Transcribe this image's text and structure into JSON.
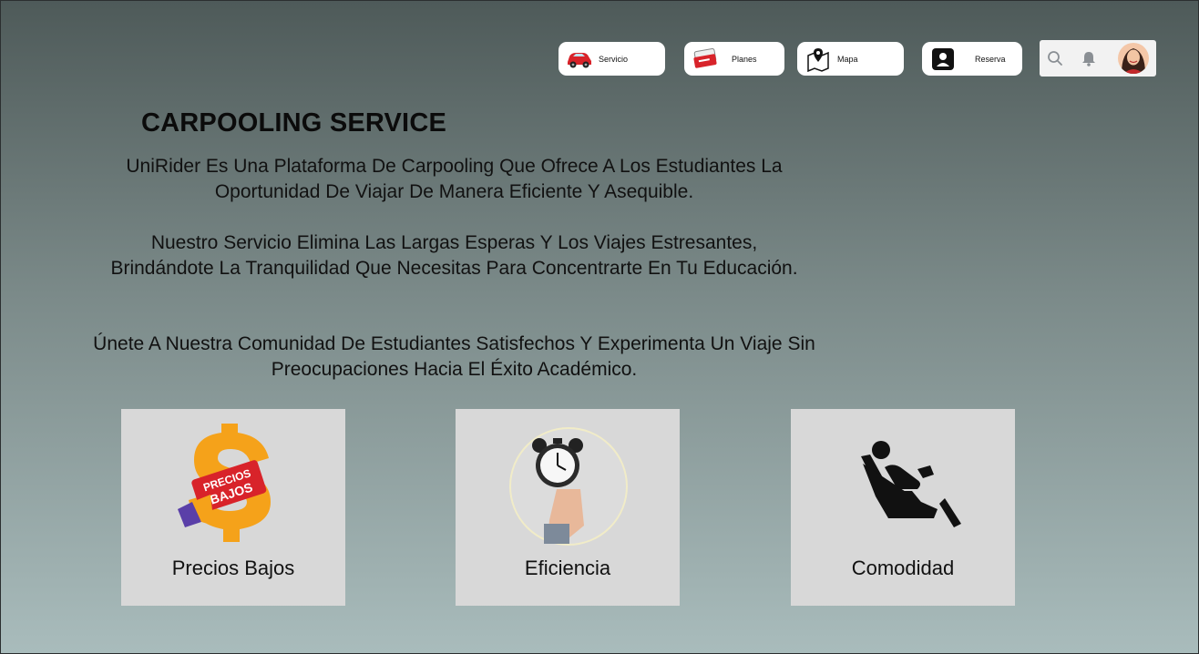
{
  "nav": {
    "items": [
      {
        "label": "Servicio",
        "icon": "car-icon"
      },
      {
        "label": "Planes",
        "icon": "ticket-icon"
      },
      {
        "label": "Mapa",
        "icon": "map-pin-icon"
      },
      {
        "label": "Reserva",
        "icon": "user-card-icon"
      }
    ],
    "utilities": {
      "search": "search-icon",
      "notifications": "bell-icon",
      "avatar": "avatar"
    }
  },
  "hero": {
    "title": "CARPOOLING SERVICE",
    "paragraphs": [
      "UniRider Es Una Plataforma De Carpooling Que Ofrece A Los Estudiantes La Oportunidad De Viajar De Manera Eficiente Y Asequible.",
      "Nuestro Servicio Elimina Las Largas Esperas Y Los Viajes Estresantes, Brindándote La Tranquilidad Que Necesitas Para Concentrarte En Tu Educación.",
      "Únete A Nuestra Comunidad De Estudiantes Satisfechos Y Experimenta Un Viaje Sin Preocupaciones Hacia El Éxito Académico."
    ]
  },
  "features": [
    {
      "label": "Precios Bajos",
      "image_text": [
        "PRECIOS",
        "BAJOS"
      ],
      "icon": "price-tag-icon"
    },
    {
      "label": "Eficiencia",
      "icon": "alarm-clock-icon"
    },
    {
      "label": "Comodidad",
      "icon": "seat-icon"
    }
  ],
  "colors": {
    "accent_orange": "#f5a21a",
    "card_bg": "#d8d8d8",
    "tag_red": "#d8232a"
  }
}
